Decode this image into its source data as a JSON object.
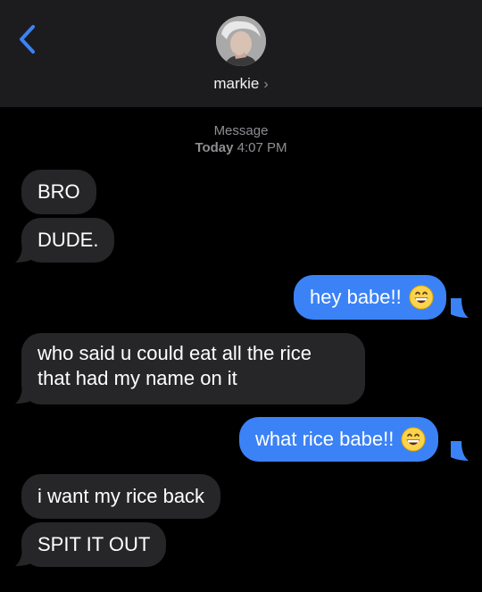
{
  "header": {
    "contact_name": "markie",
    "chevron": "›"
  },
  "meta": {
    "service": "Message",
    "day": "Today",
    "time": "4:07 PM"
  },
  "messages": [
    {
      "direction": "in",
      "text": "BRO"
    },
    {
      "direction": "in",
      "text": "DUDE."
    },
    {
      "direction": "out",
      "text": "hey babe!!",
      "emoji": "grinning-face"
    },
    {
      "direction": "in",
      "text": "who said u could eat all the rice that had my name on it"
    },
    {
      "direction": "out",
      "text": "what rice babe!!",
      "emoji": "grinning-face"
    },
    {
      "direction": "in",
      "text": "i want my rice back"
    },
    {
      "direction": "in",
      "text": "SPIT IT OUT"
    }
  ],
  "colors": {
    "background": "#000000",
    "header": "#1c1c1e",
    "incoming_bubble": "#262628",
    "outgoing_bubble": "#3b82f6",
    "back_arrow": "#3b82f6",
    "meta_text": "#8e8e93"
  },
  "icons": {
    "back": "chevron-left-icon",
    "avatar": "contact-avatar",
    "emoji": "grinning-face-emoji"
  }
}
